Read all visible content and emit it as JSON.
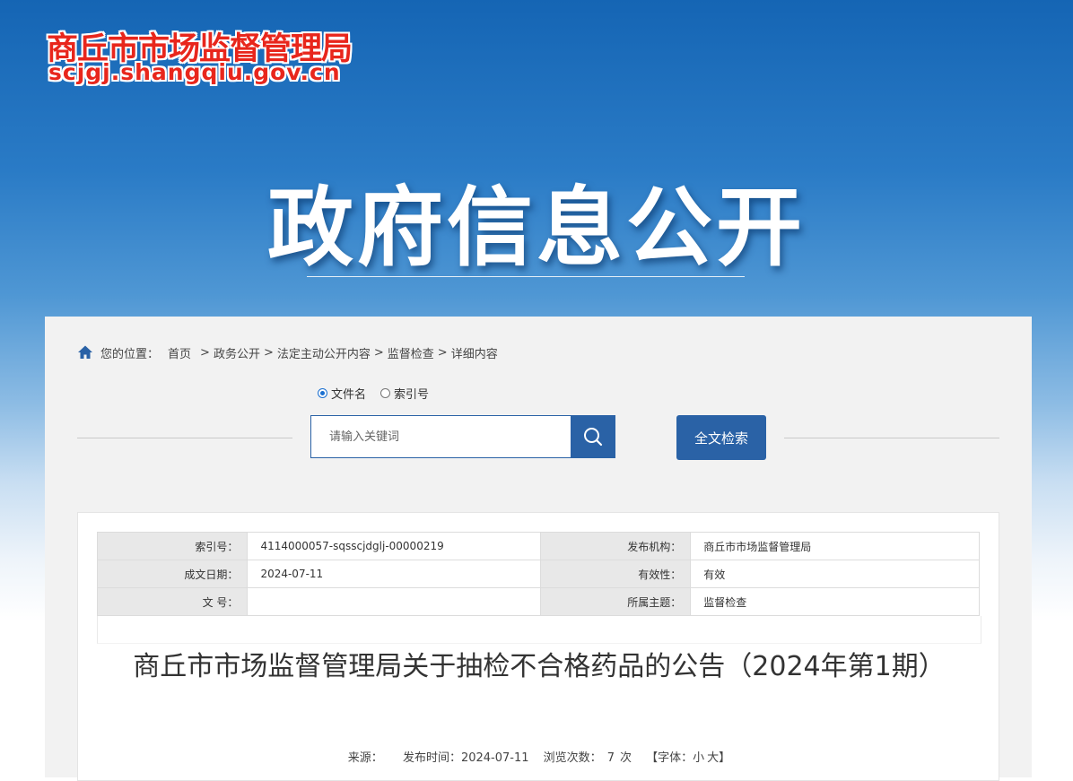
{
  "header": {
    "logo_cn": "商丘市市场监督管理局",
    "logo_en": "scjgj.shangqiu.gov.cn",
    "banner_title": "政府信息公开"
  },
  "breadcrumb": {
    "location_label": "您的位置：",
    "items": [
      "首页",
      "政务公开",
      "法定主动公开内容",
      "监督检查",
      "详细内容"
    ],
    "separator": ">"
  },
  "search": {
    "radio_options": [
      {
        "label": "文件名",
        "selected": true
      },
      {
        "label": "索引号",
        "selected": false
      }
    ],
    "placeholder": "请输入关键词",
    "value": "",
    "fulltext_button": "全文检索"
  },
  "meta_table": {
    "rows": [
      {
        "label1": "索引号：",
        "value1": "4114000057-sqsscjdglj-00000219",
        "label2": "发布机构：",
        "value2": "商丘市市场监督管理局"
      },
      {
        "label1": "成文日期：",
        "value1": "2024-07-11",
        "label2": "有效性：",
        "value2": "有效"
      },
      {
        "label1": "文 号：",
        "value1": "",
        "label2": "所属主题：",
        "value2": "监督检查"
      }
    ]
  },
  "article": {
    "title": "商丘市市场监督管理局关于抽检不合格药品的公告（2024年第1期）",
    "source_label": "来源：",
    "source_value": "",
    "publish_label": "发布时间：",
    "publish_date": "2024-07-11",
    "views_label": "浏览次数：",
    "views_count": "7",
    "views_unit": "次",
    "font_label_prefix": "【字体：",
    "font_small": "小",
    "font_large": "大",
    "font_label_suffix": "】"
  },
  "colors": {
    "brand_blue": "#2a62a6",
    "logo_red": "#e8261c"
  }
}
